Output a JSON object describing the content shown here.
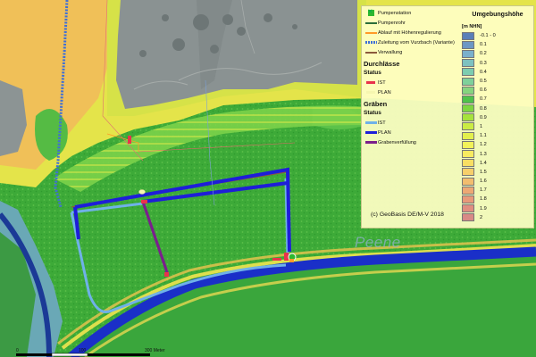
{
  "legend": {
    "items": [
      {
        "label": "Pumpenstation",
        "symbol": "pump-station-icon",
        "color": "#2eb82e"
      },
      {
        "label": "Pumpenrohr",
        "symbol": "line",
        "color": "#2b6d3a"
      },
      {
        "label": "Ablauf mit Höhenregulierung",
        "symbol": "line",
        "color": "#ff9a28"
      },
      {
        "label": "Zuleitung vom Vurzbach (Variante)",
        "symbol": "dashed-line",
        "color": "#3f6fd6"
      },
      {
        "label": "Verwallung",
        "symbol": "line",
        "color": "#8b5a3c"
      }
    ],
    "durchlaesse": {
      "heading": "Durchlässe",
      "status_label": "Status",
      "items": [
        {
          "label": "IST",
          "color": "#e8334b"
        },
        {
          "label": "PLAN",
          "color": "#f6f6b0"
        }
      ]
    },
    "graeben": {
      "heading": "Gräben",
      "status_label": "Status",
      "items": [
        {
          "label": "IST",
          "color": "#6fb1e8"
        },
        {
          "label": "PLAN",
          "color": "#1e1ed8"
        },
        {
          "label": "Grabenverfüllung",
          "color": "#7a1f8c"
        }
      ]
    },
    "copyright": "(c) GeoBasis DE/M-V 2018",
    "elevation": {
      "title": "Umgebungshöhe",
      "unit": "[m NHN]",
      "classes": [
        {
          "label": "-0.1 - 0",
          "color": "#5b7fb8"
        },
        {
          "label": "0.1",
          "color": "#6d97c4"
        },
        {
          "label": "0.2",
          "color": "#7bb0cc"
        },
        {
          "label": "0.3",
          "color": "#7ec2c0"
        },
        {
          "label": "0.4",
          "color": "#7dcdb0"
        },
        {
          "label": "0.5",
          "color": "#7fd09a"
        },
        {
          "label": "0.6",
          "color": "#86d47e"
        },
        {
          "label": "0.7",
          "color": "#4fc24a"
        },
        {
          "label": "0.8",
          "color": "#7ed640"
        },
        {
          "label": "0.9",
          "color": "#a6e23c"
        },
        {
          "label": "1",
          "color": "#caeb44"
        },
        {
          "label": "1.1",
          "color": "#e3f04c"
        },
        {
          "label": "1.2",
          "color": "#f2f25a"
        },
        {
          "label": "1.3",
          "color": "#f7ea60"
        },
        {
          "label": "1.4",
          "color": "#f8de63"
        },
        {
          "label": "1.5",
          "color": "#f6cf6a"
        },
        {
          "label": "1.6",
          "color": "#f2bd6e"
        },
        {
          "label": "1.7",
          "color": "#eda874"
        },
        {
          "label": "1.8",
          "color": "#e8997a"
        },
        {
          "label": "1.9",
          "color": "#e08e80"
        },
        {
          "label": "2",
          "color": "#d88a86"
        }
      ]
    }
  },
  "map": {
    "place_label": "Peene",
    "scale": {
      "labels": [
        "0",
        "100",
        "300 Meter"
      ]
    }
  }
}
